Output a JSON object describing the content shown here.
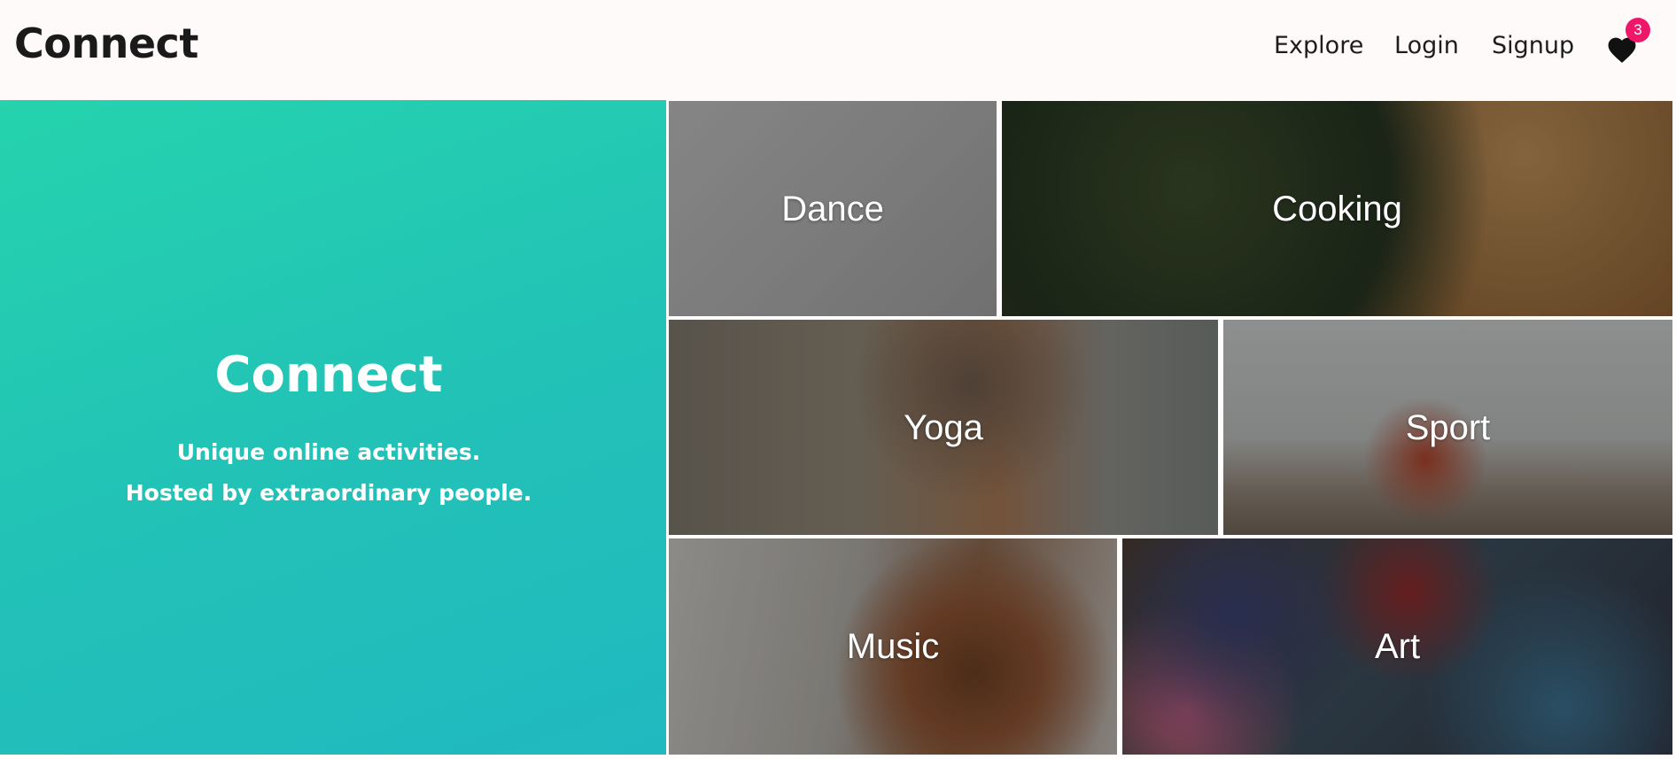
{
  "header": {
    "brand": "Connect",
    "nav": {
      "explore": "Explore",
      "login": "Login",
      "signup": "Signup"
    },
    "favorites": {
      "icon": "heart-icon",
      "count": "3",
      "badge_color": "#f0176b"
    }
  },
  "hero": {
    "title": "Connect",
    "line1": "Unique online activities.",
    "line2": "Hosted by extraordinary people.",
    "gradient": [
      "#25d3ad",
      "#20b9c0"
    ]
  },
  "categories": [
    {
      "label": "Dance"
    },
    {
      "label": "Cooking"
    },
    {
      "label": "Yoga"
    },
    {
      "label": "Sport"
    },
    {
      "label": "Music"
    },
    {
      "label": "Art"
    }
  ]
}
